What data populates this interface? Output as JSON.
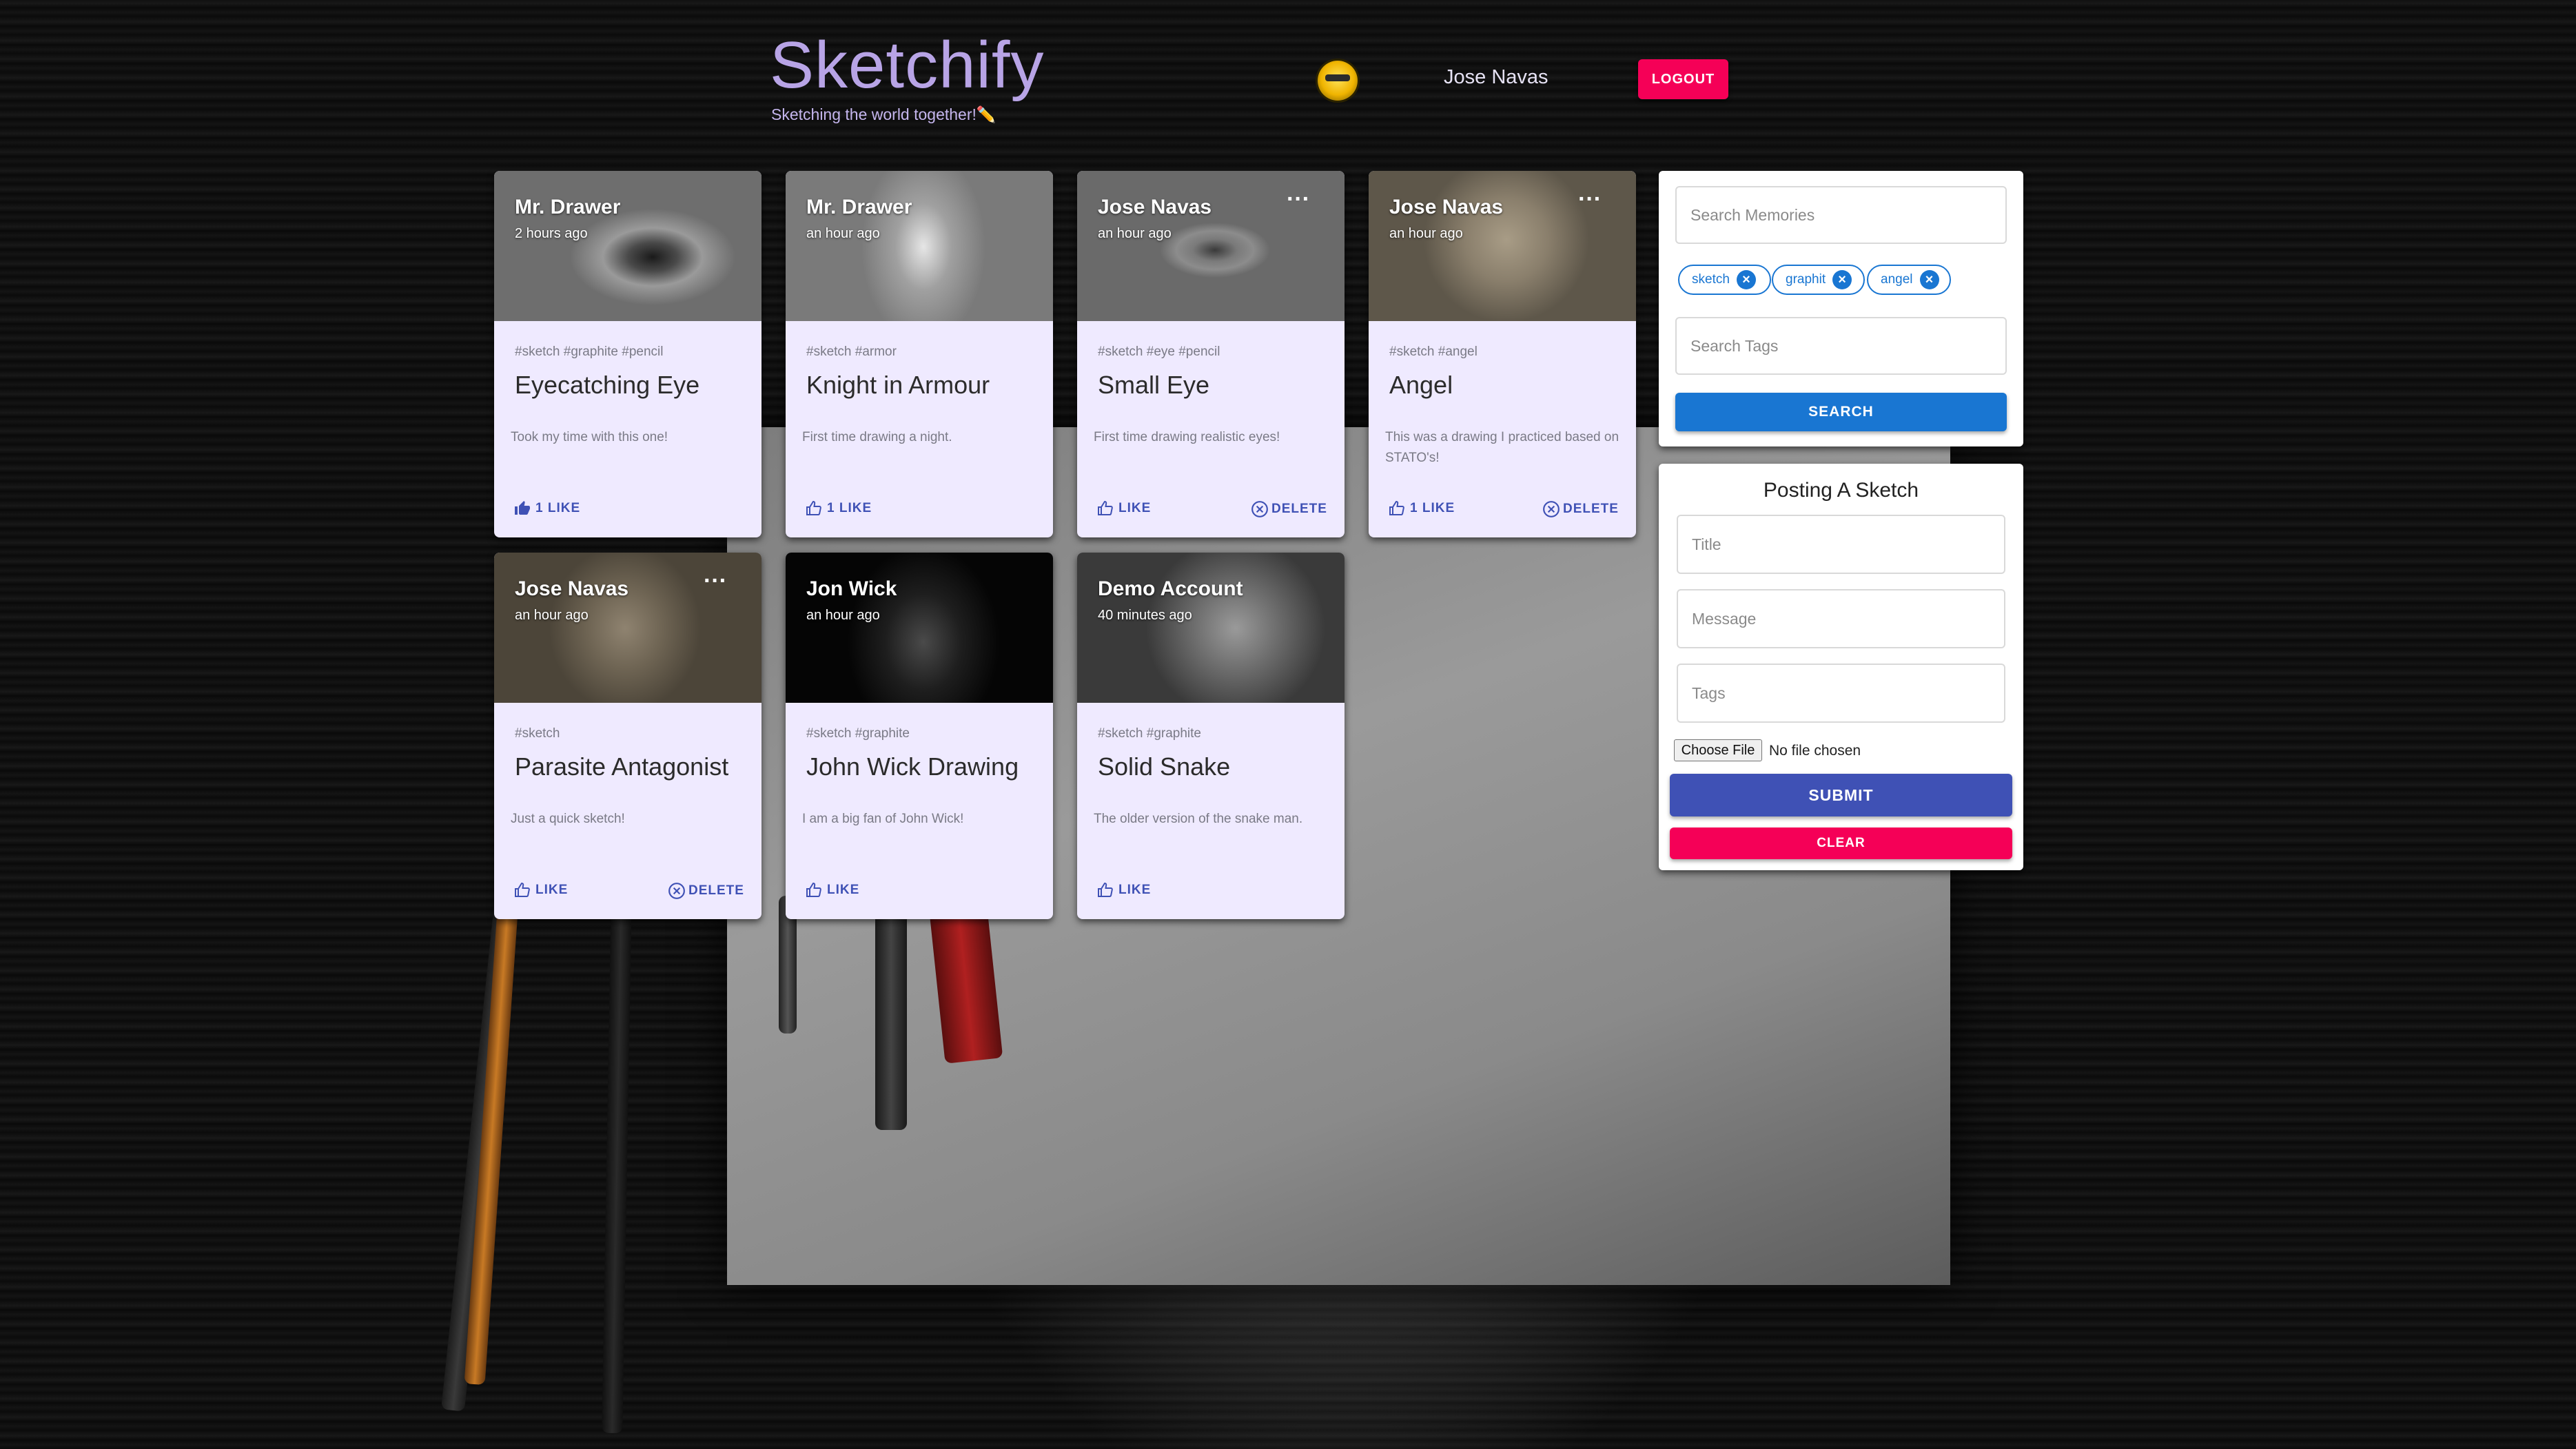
{
  "header": {
    "brand_title": "Sketchify",
    "brand_subtitle": "Sketching the world together!",
    "brand_emoji": "✏️",
    "user_name": "Jose Navas",
    "logout_label": "LOGOUT"
  },
  "posts": [
    {
      "author": "Mr. Drawer",
      "time": "2 hours ago",
      "tags": "#sketch #graphite #pencil",
      "title": "Eyecatching Eye",
      "message": "Took my time with this one!",
      "like": "1 LIKE",
      "liked": true,
      "delete": "",
      "more": false
    },
    {
      "author": "Mr. Drawer",
      "time": "an hour ago",
      "tags": "#sketch #armor",
      "title": "Knight in Armour",
      "message": "First time drawing a night.",
      "like": "1 LIKE",
      "liked": false,
      "delete": "",
      "more": false
    },
    {
      "author": "Jose Navas",
      "time": "an hour ago",
      "tags": "#sketch #eye #pencil",
      "title": "Small Eye",
      "message": "First time drawing realistic eyes!",
      "like": "LIKE",
      "liked": false,
      "delete": "DELETE",
      "more": true
    },
    {
      "author": "Jose Navas",
      "time": "an hour ago",
      "tags": "#sketch #angel",
      "title": "Angel",
      "message": "This was a drawing I practiced based on STATO's!",
      "like": "1 LIKE",
      "liked": false,
      "delete": "DELETE",
      "more": true
    },
    {
      "author": "Jose Navas",
      "time": "an hour ago",
      "tags": "#sketch",
      "title": "Parasite Antagonist",
      "message": "Just a quick sketch!",
      "like": "LIKE",
      "liked": false,
      "delete": "DELETE",
      "more": true
    },
    {
      "author": "Jon Wick",
      "time": "an hour ago",
      "tags": "#sketch #graphite",
      "title": "John Wick Drawing",
      "message": "I am a big fan of John Wick!",
      "like": "LIKE",
      "liked": false,
      "delete": "",
      "more": false
    },
    {
      "author": "Demo Account",
      "time": "40 minutes ago",
      "tags": "#sketch #graphite",
      "title": "Solid Snake",
      "message": "The older version of the snake man.",
      "like": "LIKE",
      "liked": false,
      "delete": "",
      "more": false
    }
  ],
  "search": {
    "memories_placeholder": "Search Memories",
    "chips": [
      "sketch",
      "graphit",
      "angel"
    ],
    "tags_placeholder": "Search Tags",
    "button_label": "SEARCH"
  },
  "form": {
    "title": "Posting A Sketch",
    "title_placeholder": "Title",
    "message_placeholder": "Message",
    "tags_placeholder": "Tags",
    "file_button": "Choose File",
    "file_status": "No file chosen",
    "submit_label": "SUBMIT",
    "clear_label": "CLEAR"
  },
  "colors": {
    "accent_pink": "#f50057",
    "primary_indigo": "#3f51b5",
    "search_blue": "#1976d2",
    "card_bg": "#efeaff",
    "brand_purple": "#b8a4e6"
  }
}
